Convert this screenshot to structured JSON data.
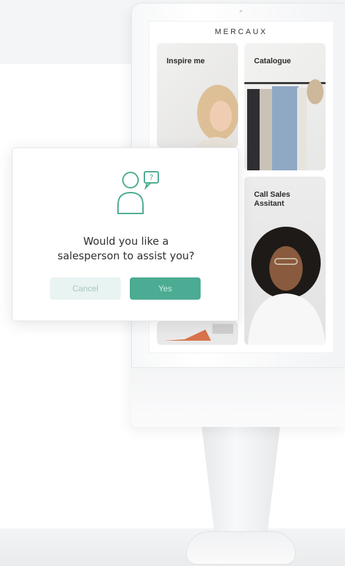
{
  "kiosk": {
    "brand": "MERCAUX",
    "tiles": [
      {
        "label": "Inspire me"
      },
      {
        "label": "Catalogue"
      },
      {
        "label": "Call Sales\nAssitant"
      }
    ]
  },
  "dialog": {
    "question_line1": "Would you like a",
    "question_line2": "salesperson to assist you?",
    "cancel_label": "Cancel",
    "yes_label": "Yes",
    "icon": "salesperson-question-icon"
  },
  "colors": {
    "accent": "#4cab93",
    "accent_light": "#e8f3f2"
  }
}
